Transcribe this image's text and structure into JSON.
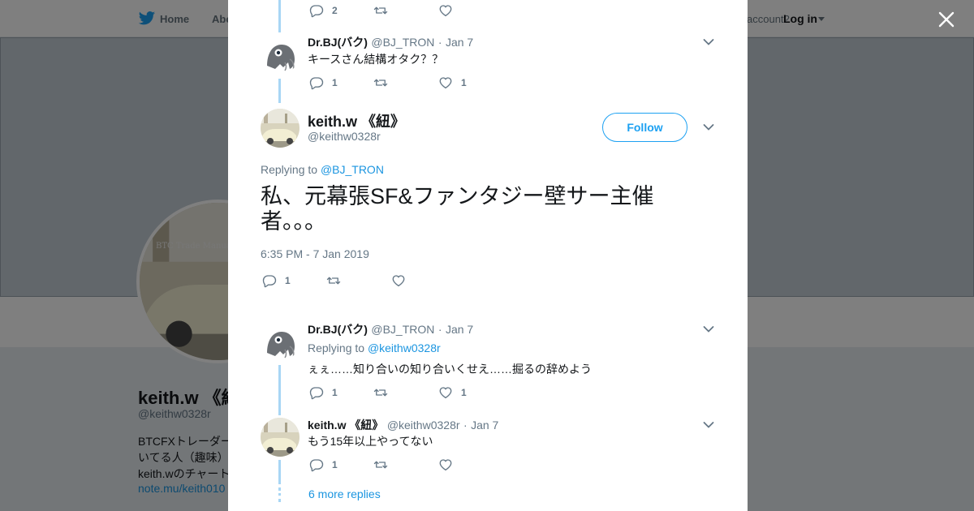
{
  "nav": {
    "home_label": "Home",
    "about_label": "Abo",
    "account_prompt": "account?",
    "login_label": "Log in"
  },
  "profile": {
    "name": "keith.w 《紐",
    "handle": "@keithw0328r",
    "bio_lines": [
      "BTCFXトレーダー",
      "いてる人（趣味）",
      "keith.wのチャート"
    ],
    "link_text": "note.mu/keith010",
    "avatar_overlay_text": "BTC Trade Manual"
  },
  "thread": {
    "top_reply": {
      "reply_count": "2"
    },
    "reply1": {
      "name": "Dr.BJ(バク)",
      "handle": "@BJ_TRON",
      "date": "Jan 7",
      "text": "キースさん結構オタク？？",
      "reply_count": "1",
      "like_count": "1"
    },
    "main": {
      "name": "keith.w 《紐》",
      "handle": "@keithw0328r",
      "follow_label": "Follow",
      "replying_prefix": "Replying to",
      "replying_to": "@BJ_TRON",
      "text_line1": "私、元幕張SF&ファンタジー壁サー主催",
      "text_line2": "者。。。",
      "timestamp": "6:35 PM - 7 Jan 2019",
      "reply_count": "1"
    },
    "reply2": {
      "name": "Dr.BJ(バク)",
      "handle": "@BJ_TRON",
      "date": "Jan 7",
      "replying_prefix": "Replying to",
      "replying_to": "@keithw0328r",
      "text": "ぇぇ……知り合いの知り合いくせえ……掘るの辞めよう",
      "reply_count": "1",
      "like_count": "1"
    },
    "reply3": {
      "name": "keith.w 《紐》",
      "handle": "@keithw0328r",
      "date": "Jan 7",
      "text": "もう15年以上やってない",
      "reply_count": "1"
    },
    "more_replies": "6 more replies"
  },
  "icons": {
    "close": "close-icon",
    "reply": "reply-icon",
    "retweet": "retweet-icon",
    "like": "heart-icon",
    "chevron": "chevron-down-icon",
    "logo": "twitter-bird-icon"
  },
  "colors": {
    "accent": "#1da1f2",
    "link": "#1b95e0",
    "thread_line": "#a8d6f5",
    "muted": "#657786"
  }
}
